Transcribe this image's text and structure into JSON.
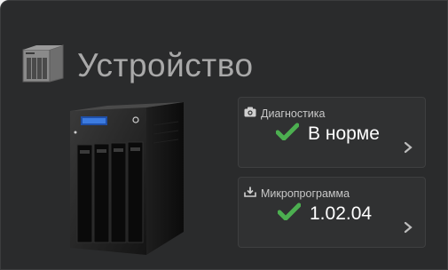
{
  "section": {
    "title": "Устройство",
    "icon": "device-icon"
  },
  "diagnostics": {
    "label": "Диагностика",
    "icon": "camera-icon",
    "status": "В норме",
    "status_icon": "checkmark-icon"
  },
  "firmware": {
    "label": "Микропрограмма",
    "icon": "download-icon",
    "version": "1.02.04",
    "status_icon": "checkmark-icon"
  },
  "colors": {
    "panel_bg": "#2a2b2c",
    "title_text": "#a9a9a9",
    "success_green": "#4caf50"
  }
}
